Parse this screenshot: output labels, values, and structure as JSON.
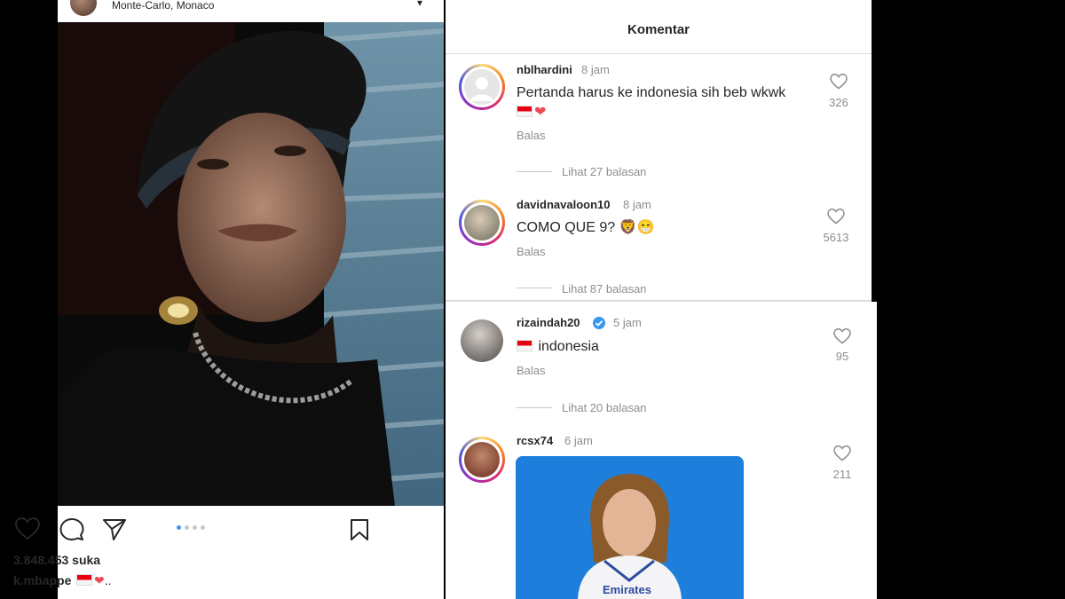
{
  "post": {
    "location": "Monte-Carlo, Monaco",
    "more_icon": "more-icon",
    "likes": "3.848.453 suka",
    "caption_user": "k.mbappe",
    "caption_text": "..",
    "icons": [
      "heart-icon",
      "comment-icon",
      "share-icon",
      "bookmark-icon"
    ],
    "carousel": {
      "total": 4,
      "active": 1
    }
  },
  "comments_header": {
    "title": "Komentar"
  },
  "comments": [
    {
      "username": "nblhardini",
      "time": "8 jam",
      "text": "Pertanda harus ke indonesia sih beb wkwk",
      "emoji": [
        "flag-indonesia",
        "red-heart"
      ],
      "reply_label": "Balas",
      "likes": "326",
      "view_replies": "Lihat 27 balasan"
    },
    {
      "username": "davidnavaloon10",
      "time": "8 jam",
      "text": "COMO QUE 9? 🦁😁",
      "reply_label": "Balas",
      "likes": "5613",
      "view_replies": "Lihat 87 balasan"
    },
    {
      "username": "rizaindah20",
      "time": "5 jam",
      "verified": true,
      "text": "indonesia",
      "reply_label": "Balas",
      "likes": "95",
      "view_replies": "Lihat 20 balasan"
    },
    {
      "username": "rcsx74",
      "time": "6 jam",
      "likes": "211",
      "media_text": "Emirates"
    }
  ],
  "colors": {
    "link_blue": "#3897f0",
    "muted": "#8e8e8e",
    "text": "#262626",
    "heart_red": "#ed4956",
    "media_bg": "#1d7fdb"
  }
}
